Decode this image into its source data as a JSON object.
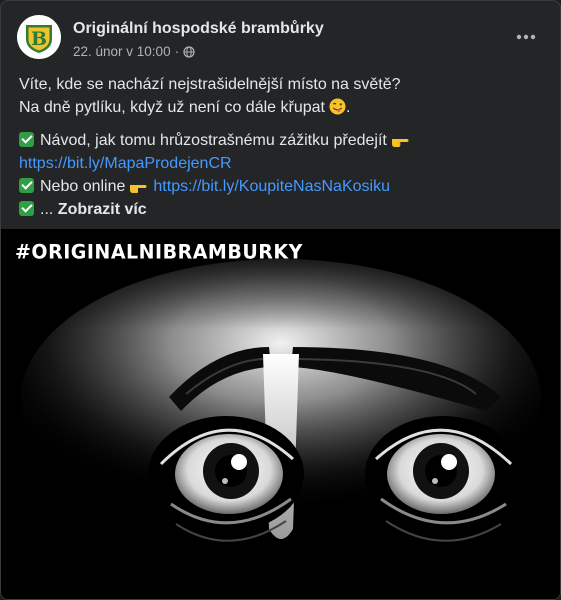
{
  "post": {
    "page_name": "Originální hospodské brambůrky",
    "date": "22. únor v 10:00",
    "separator": "·",
    "avatar_letter": "B",
    "body": {
      "line1": "Víte, kde se nachází nejstrašidelnější místo na světě?",
      "line2": "Na dně pytlíku, když už není co dále křupat",
      "line2_end": ".",
      "item1_text": "Návod, jak tomu hrůzostrašnému zážitku předejít",
      "item1_link": "https://bit.ly/MapaProdejenCR",
      "item2_text": "Nebo online",
      "item2_link": "https://bit.ly/KoupiteNasNaKosiku",
      "item3_prefix": "...",
      "see_more": "Zobrazit víc"
    },
    "image": {
      "hashtag": "#ORIGINALNIBRAMBURKY"
    }
  },
  "colors": {
    "card_bg": "#242526",
    "text": "#e4e6eb",
    "secondary_text": "#b0b3b8",
    "link": "#4599ff",
    "check": "#2f9e44",
    "avatar_yellow": "#f2c12e",
    "avatar_green": "#2e7d32"
  },
  "icons": [
    "globe-icon",
    "more-options-icon",
    "check-mark-icon",
    "pointing-hand-icon",
    "winking-tongue-emoji"
  ]
}
